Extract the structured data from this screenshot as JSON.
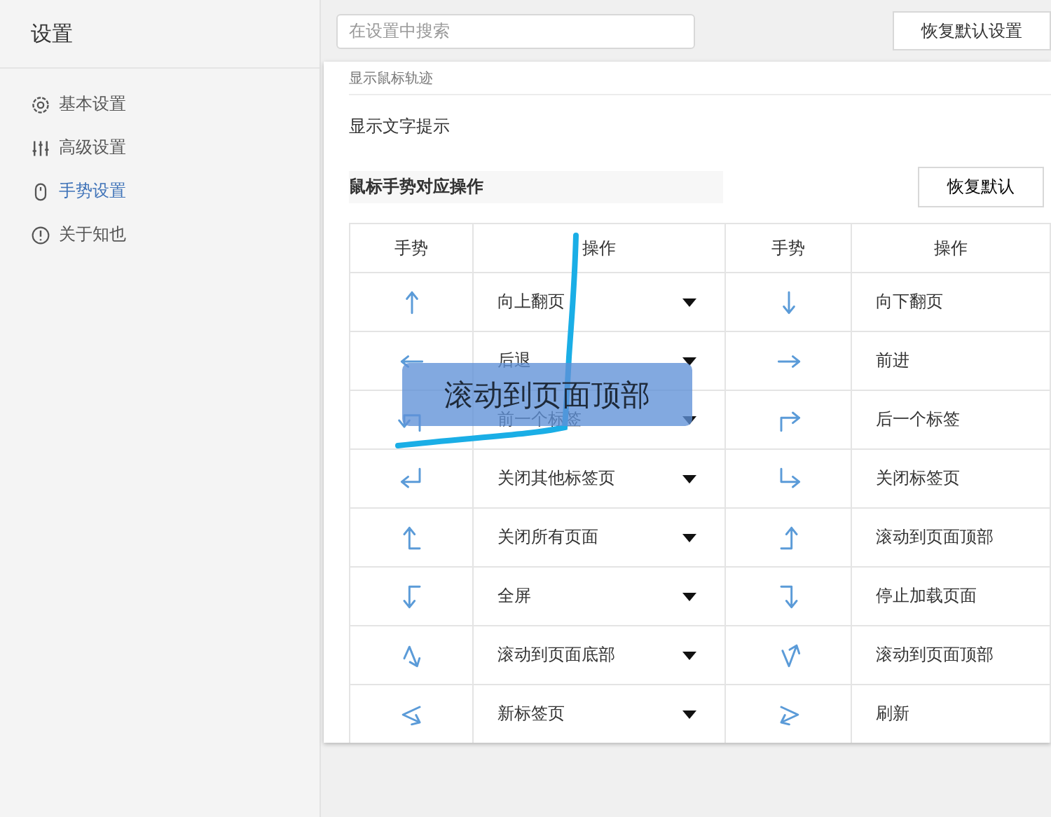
{
  "sidebar": {
    "title": "设置",
    "items": [
      {
        "label": "基本设置",
        "selected": false
      },
      {
        "label": "高级设置",
        "selected": false
      },
      {
        "label": "手势设置",
        "selected": true
      },
      {
        "label": "关于知也",
        "selected": false
      }
    ]
  },
  "header": {
    "search": {
      "placeholder": "在设置中搜索"
    },
    "reset_all_button": "恢复默认设置"
  },
  "options": [
    "显示鼠标轨迹",
    "显示文字提示"
  ],
  "gestures": {
    "title": "鼠标手势对应操作",
    "reset_button": "恢复默认",
    "columns": [
      "手势",
      "操作",
      "手势",
      "操作"
    ],
    "rows": [
      {
        "left": {
          "kind": "up",
          "action": "向上翻页"
        },
        "right": {
          "kind": "down",
          "action": "向下翻页"
        }
      },
      {
        "left": {
          "kind": "left",
          "action": "后退"
        },
        "right": {
          "kind": "right",
          "action": "前进"
        }
      },
      {
        "left": {
          "kind": "up-left-down",
          "action": "前一个标签"
        },
        "right": {
          "kind": "up-right",
          "action": "后一个标签"
        }
      },
      {
        "left": {
          "kind": "down-left",
          "action": "关闭其他标签页"
        },
        "right": {
          "kind": "down-right",
          "action": "关闭标签页"
        }
      },
      {
        "left": {
          "kind": "left-up",
          "action": "关闭所有页面"
        },
        "right": {
          "kind": "right-up",
          "action": "滚动到页面顶部"
        }
      },
      {
        "left": {
          "kind": "left-down",
          "action": "全屏"
        },
        "right": {
          "kind": "right-down",
          "action": "停止加载页面"
        }
      },
      {
        "left": {
          "kind": "up-down",
          "action": "滚动到页面底部"
        },
        "right": {
          "kind": "down-up",
          "action": "滚动到页面顶部"
        }
      },
      {
        "left": {
          "kind": "left-right",
          "action": "新标签页"
        },
        "right": {
          "kind": "right-left",
          "action": "刷新"
        }
      }
    ]
  },
  "gesture_hint": "滚动到页面顶部"
}
